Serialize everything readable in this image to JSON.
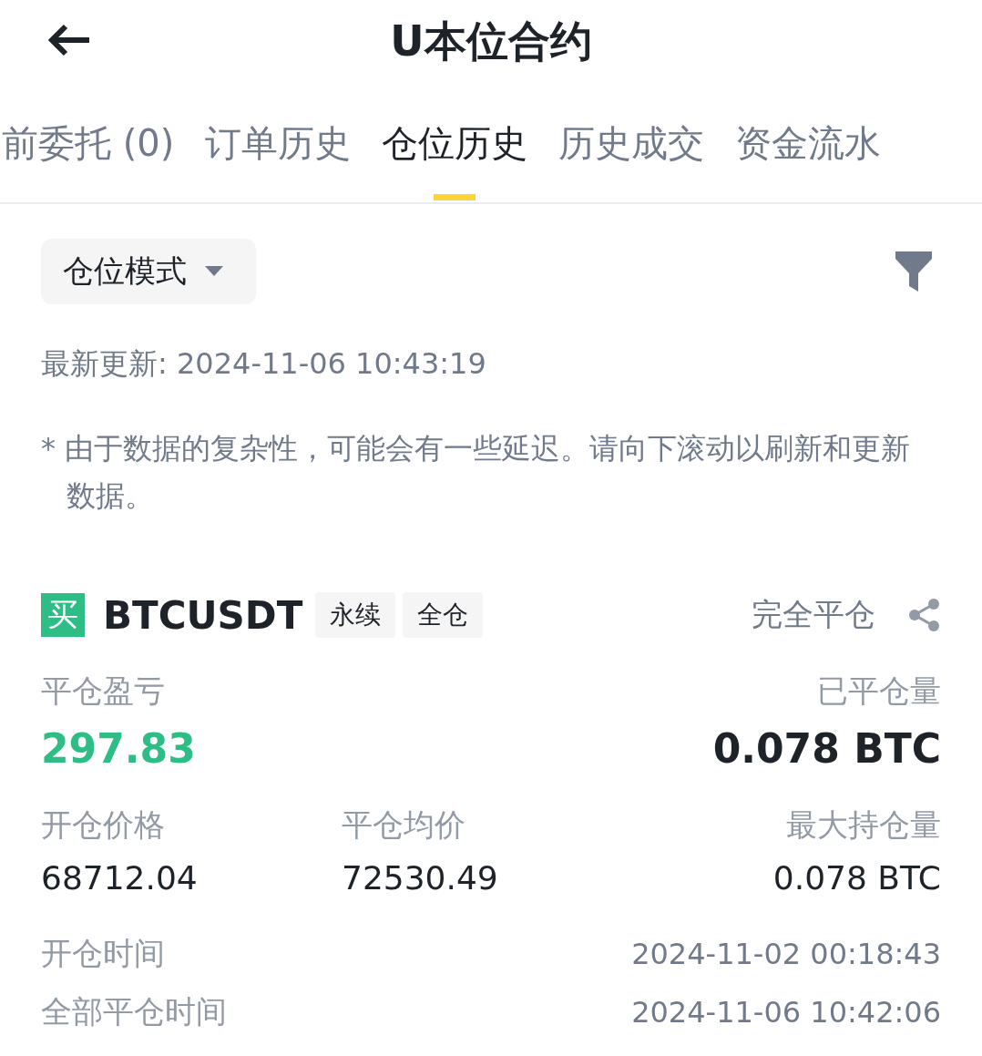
{
  "header": {
    "title": "U本位合约"
  },
  "tabs": [
    {
      "label": "前委托 (0)",
      "selected": false
    },
    {
      "label": "订单历史",
      "selected": false
    },
    {
      "label": "仓位历史",
      "selected": true
    },
    {
      "label": "历史成交",
      "selected": false
    },
    {
      "label": "资金流水",
      "selected": false
    }
  ],
  "mode_dropdown": {
    "label": "仓位模式"
  },
  "last_update": "最新更新: 2024-11-06 10:43:19",
  "note": "* 由于数据的复杂性，可能会有一些延迟。请向下滚动以刷新和更新数据。",
  "position": {
    "side": "买",
    "symbol": "BTCUSDT",
    "tags": [
      "永续",
      "全仓"
    ],
    "status": "完全平仓",
    "pnl_label": "平仓盈亏",
    "pnl": "297.83",
    "closed_label": "已平仓量",
    "closed": "0.078 BTC",
    "fields": [
      {
        "label": "开仓价格",
        "value": "68712.04"
      },
      {
        "label": "平仓均价",
        "value": "72530.49"
      },
      {
        "label": "最大持仓量",
        "value": "0.078 BTC"
      }
    ],
    "times": [
      {
        "label": "开仓时间",
        "value": "2024-11-02 00:18:43"
      },
      {
        "label": "全部平仓时间",
        "value": "2024-11-06 10:42:06"
      }
    ]
  }
}
